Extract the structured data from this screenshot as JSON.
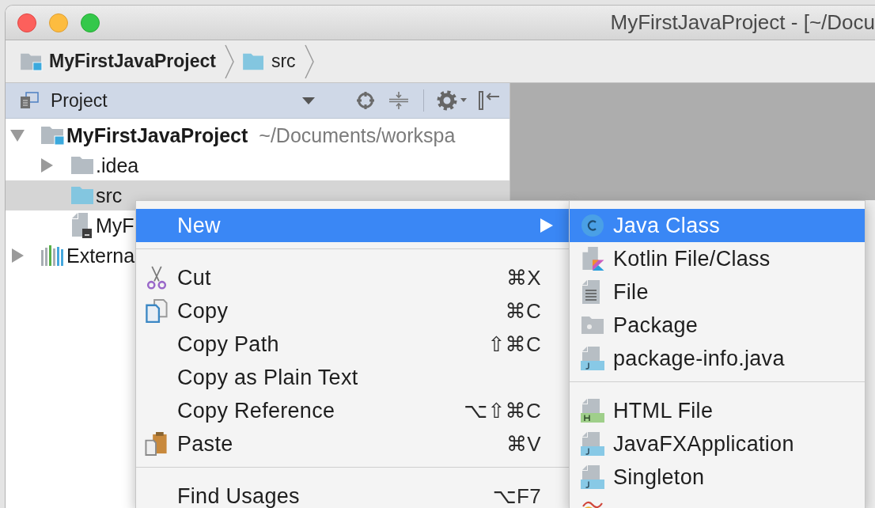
{
  "window": {
    "title": "MyFirstJavaProject - [~/Docu"
  },
  "breadcrumbs": [
    {
      "label": "MyFirstJavaProject",
      "kind": "project"
    },
    {
      "label": "src",
      "kind": "source"
    }
  ],
  "project_panel": {
    "title": "Project"
  },
  "tree": [
    {
      "label": "MyFirstJavaProject",
      "path": "~/Documents/workspa",
      "kind": "project",
      "expanded": true,
      "selected": false,
      "children": [
        {
          "label": ".idea",
          "kind": "folder",
          "expanded": false,
          "selected": false
        },
        {
          "label": "src",
          "kind": "source",
          "selected": true
        },
        {
          "label": "MyF",
          "kind": "module_file",
          "selected": false
        }
      ]
    },
    {
      "label": "Externa",
      "kind": "libraries",
      "expanded": false,
      "selected": false
    }
  ],
  "context_menu": {
    "groups": [
      {
        "items": [
          {
            "label": "New",
            "kind": "submenu",
            "selected": true
          }
        ]
      },
      {
        "items": [
          {
            "label": "Cut",
            "kind": "cut",
            "shortcut": "⌘X",
            "selected": false
          },
          {
            "label": "Copy",
            "kind": "copy",
            "shortcut": "⌘C",
            "selected": false
          },
          {
            "label": "Copy Path",
            "kind": "plain",
            "shortcut": "⇧⌘C",
            "selected": false
          },
          {
            "label": "Copy as Plain Text",
            "kind": "plain",
            "selected": false
          },
          {
            "label": "Copy Reference",
            "kind": "plain",
            "shortcut": "⌥⇧⌘C",
            "selected": false
          },
          {
            "label": "Paste",
            "kind": "paste",
            "shortcut": "⌘V",
            "selected": false
          }
        ]
      },
      {
        "items": [
          {
            "label": "Find Usages",
            "kind": "plain",
            "shortcut": "⌥F7",
            "selected": false
          }
        ]
      }
    ]
  },
  "new_submenu": {
    "groups": [
      {
        "items": [
          {
            "label": "Java Class",
            "kind": "class",
            "selected": true
          },
          {
            "label": "Kotlin File/Class",
            "kind": "kotlin",
            "selected": false
          },
          {
            "label": "File",
            "kind": "file",
            "selected": false
          },
          {
            "label": "Package",
            "kind": "package",
            "selected": false
          },
          {
            "label": "package-info.java",
            "kind": "java",
            "selected": false
          }
        ]
      },
      {
        "items": [
          {
            "label": "HTML File",
            "kind": "html",
            "selected": false
          },
          {
            "label": "JavaFXApplication",
            "kind": "java",
            "selected": false
          },
          {
            "label": "Singleton",
            "kind": "java",
            "selected": false
          },
          {
            "kind": "salt",
            "selected": false
          }
        ]
      }
    ]
  }
}
